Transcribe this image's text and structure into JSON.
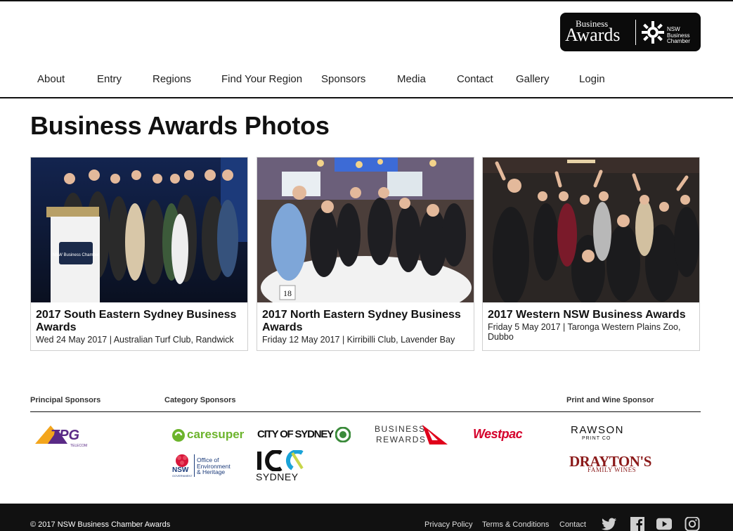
{
  "brand": {
    "logo_business": "Business",
    "logo_awards": "Awards",
    "logo_chamber_lines": [
      "NSW",
      "Business",
      "Chamber"
    ]
  },
  "nav": [
    "About",
    "Entry",
    "Regions",
    "Find Your Region",
    "Sponsors",
    "Media",
    "Contact",
    "Gallery",
    "Login"
  ],
  "page_title": "Business Awards Photos",
  "cards": [
    {
      "title": "2017 South Eastern Sydney Business Awards",
      "meta": "Wed 24 May 2017 | Australian Turf Club, Randwick",
      "podium_label": "NSW Business Chamber"
    },
    {
      "title": "2017 North Eastern Sydney Business Awards",
      "meta": "Friday 12 May 2017 | Kirribilli Club, Lavender Bay",
      "table_number": "18"
    },
    {
      "title": "2017 Western NSW Business Awards",
      "meta": "Friday 5 May 2017 | Taronga Western Plains Zoo, Dubbo"
    }
  ],
  "sponsors": {
    "principal_heading": "Principal Sponsors",
    "category_heading": "Category Sponsors",
    "print_wine_heading": "Print and Wine Sponsor",
    "tpg": "TPG",
    "tpg_sub": "TELECOM",
    "caresuper": "caresuper",
    "cityofsydney": "CITY OF SYDNEY",
    "business_rewards_1": "BUSINESS",
    "business_rewards_2": "REWARDS",
    "westpac": "Westpac",
    "rawson_1": "RAWSON",
    "rawson_2": "PRINT CO",
    "nsw_gov_short": "NSW",
    "nsw_gov_sub": "GOVERNMENT",
    "oeh_lines": [
      "Office of",
      "Environment",
      "& Heritage"
    ],
    "icc": "ICC",
    "icc_sub": "SYDNEY",
    "draytons_1": "DRAYTON'S",
    "draytons_2": "FAMILY WINES"
  },
  "footer": {
    "copyright": "© 2017 NSW Business Chamber Awards",
    "links": [
      "Privacy Policy",
      "Terms & Conditions",
      "Contact"
    ]
  },
  "icons": [
    "twitter-icon",
    "facebook-icon",
    "youtube-icon",
    "instagram-icon"
  ],
  "colors": {
    "black": "#111111",
    "footer_bg": "#111111",
    "westpac_red": "#d5002b",
    "qantas_red": "#e0001b",
    "caresuper_green": "#6cb42c",
    "draytons_red": "#8b1a1a"
  }
}
